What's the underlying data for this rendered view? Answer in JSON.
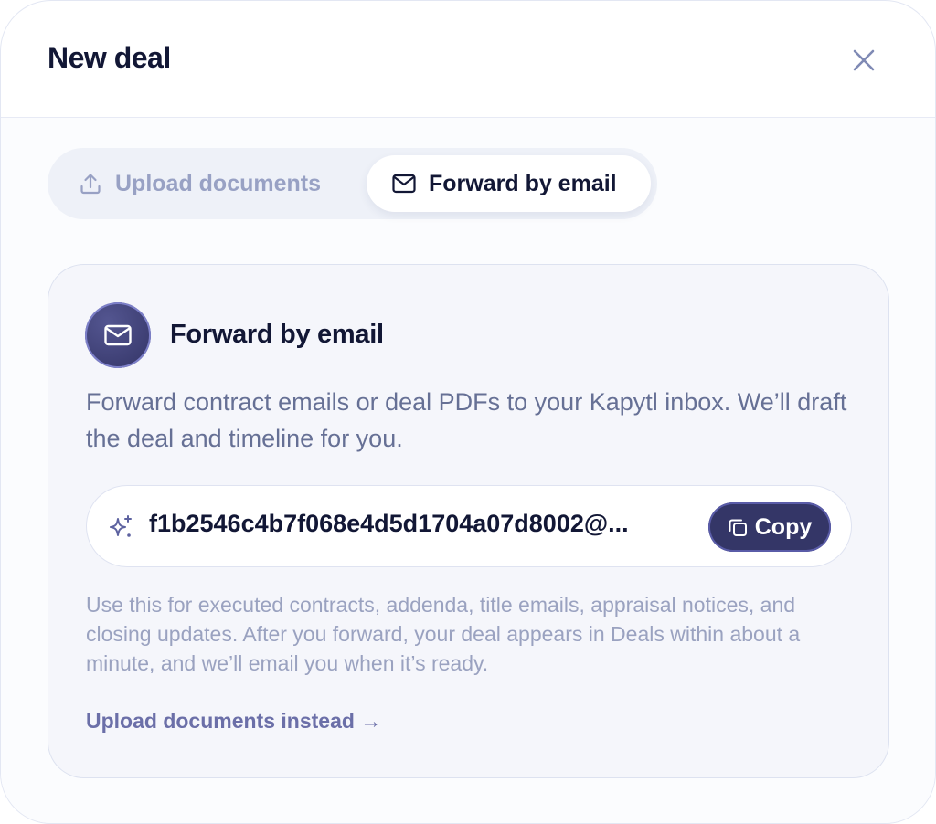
{
  "modal": {
    "title": "New deal"
  },
  "tabs": [
    {
      "label": "Upload documents",
      "icon": "upload-icon",
      "active": false
    },
    {
      "label": "Forward by email",
      "icon": "mail-icon",
      "active": true
    }
  ],
  "card": {
    "icon": "mail-icon",
    "title": "Forward by email",
    "description": "Forward contract emails or deal PDFs to your Kapytl inbox. We’ll draft the deal and timeline for you.",
    "address": "f1b2546c4b7f068e4d5d1704a07d8002@...",
    "copy_label": "Copy",
    "note": "Use this for executed contracts, addenda, title emails, appraisal notices, and closing updates. After you forward, your deal appears in Deals within about a minute, and we’ll email you when it’s ready.",
    "alt_link": "Upload documents instead →"
  },
  "colors": {
    "primary": "#343667",
    "title_text": "#121735",
    "muted_text": "#667095",
    "light_text": "#9aa2c0"
  }
}
